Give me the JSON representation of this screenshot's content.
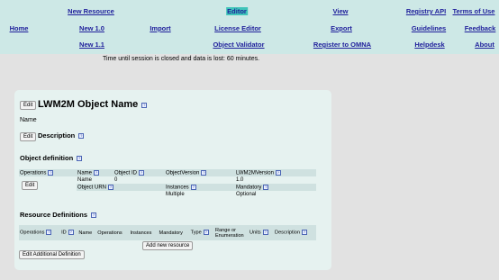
{
  "nav": {
    "row1": [
      "New Resource",
      "Editor",
      "View",
      "Registry API",
      "Terms of Use"
    ],
    "row2": [
      "Home",
      "New 1.0",
      "Import",
      "License Editor",
      "Export",
      "Guidelines",
      "Feedback"
    ],
    "row3": [
      "New 1.1",
      "Object Validator",
      "Register to OMNA",
      "Helpdesk",
      "About"
    ],
    "active": "Editor"
  },
  "session_notice": "Time until session is closed and data is lost: 60 minutes.",
  "editor": {
    "edit_label": "Edit",
    "title": "LWM2M Object Name",
    "name_label": "Name",
    "description_label": "Description",
    "help_glyph": "?",
    "object_definition": {
      "heading": "Object definition",
      "operations_label": "Operations",
      "row1_headers": [
        "Name",
        "Object ID",
        "ObjectVersion",
        "LWM2MVersion"
      ],
      "row1_values": [
        "Name",
        "0",
        "",
        "1.0"
      ],
      "row2_headers": [
        "Object URN",
        "",
        "Instances",
        "Mandatory"
      ],
      "row2_values": [
        "",
        "",
        "Multiple",
        "Optional"
      ]
    },
    "resource_definitions": {
      "heading": "Resource Definitions",
      "columns": [
        "Operations",
        "ID",
        "Name",
        "Operations",
        "Instances",
        "Mandatory",
        "Type",
        "Range or Enumeration",
        "Units",
        "Description"
      ],
      "add_button": "Add new resource"
    },
    "additional_button": "Edit Additional Definition"
  }
}
